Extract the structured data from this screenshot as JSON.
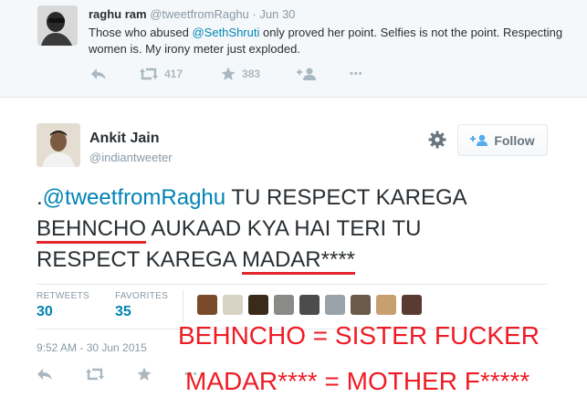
{
  "top_tweet": {
    "name": "raghu ram",
    "handle": "@tweetfromRaghu",
    "separator": "·",
    "time": "Jun 30",
    "text_before": "Those who abused ",
    "mention": "@SethShruti",
    "text_after": " only proved her point. Selfies is not the point. Respecting women is. My irony meter just exploded.",
    "retweet_count": "417",
    "favorite_count": "383",
    "more": "•••"
  },
  "main_tweet": {
    "name": "Ankit Jain",
    "handle": "@indiantweeter",
    "follow_label": "Follow",
    "text_prefix": ".",
    "mention": "@tweetfromRaghu",
    "text_1": " TU RESPECT KAREGA",
    "word_1": "BEHNCHO",
    "text_2": " AUKAAD KYA HAI TERI TU",
    "text_3": "RESPECT KAREGA ",
    "word_2": "MADAR****",
    "retweets_label": "RETWEETS",
    "retweets_value": "30",
    "favorites_label": "FAVORITES",
    "favorites_value": "35",
    "timestamp": "9:52 AM - 30 Jun 2015"
  },
  "annotations": {
    "line_1": "BEHNCHO = SISTER FUCKER",
    "line_2": "MADAR**** = MOTHER F*****"
  },
  "colors": {
    "link": "#0084b4",
    "annotation": "#ee1c25",
    "muted": "#8899a6",
    "icon": "#aab8c2"
  },
  "icons": [
    "reply-icon",
    "retweet-icon",
    "favorite-icon",
    "follow-user-icon",
    "more-icon",
    "gear-icon",
    "add-user-icon"
  ],
  "favoriters_count_shown": 9
}
